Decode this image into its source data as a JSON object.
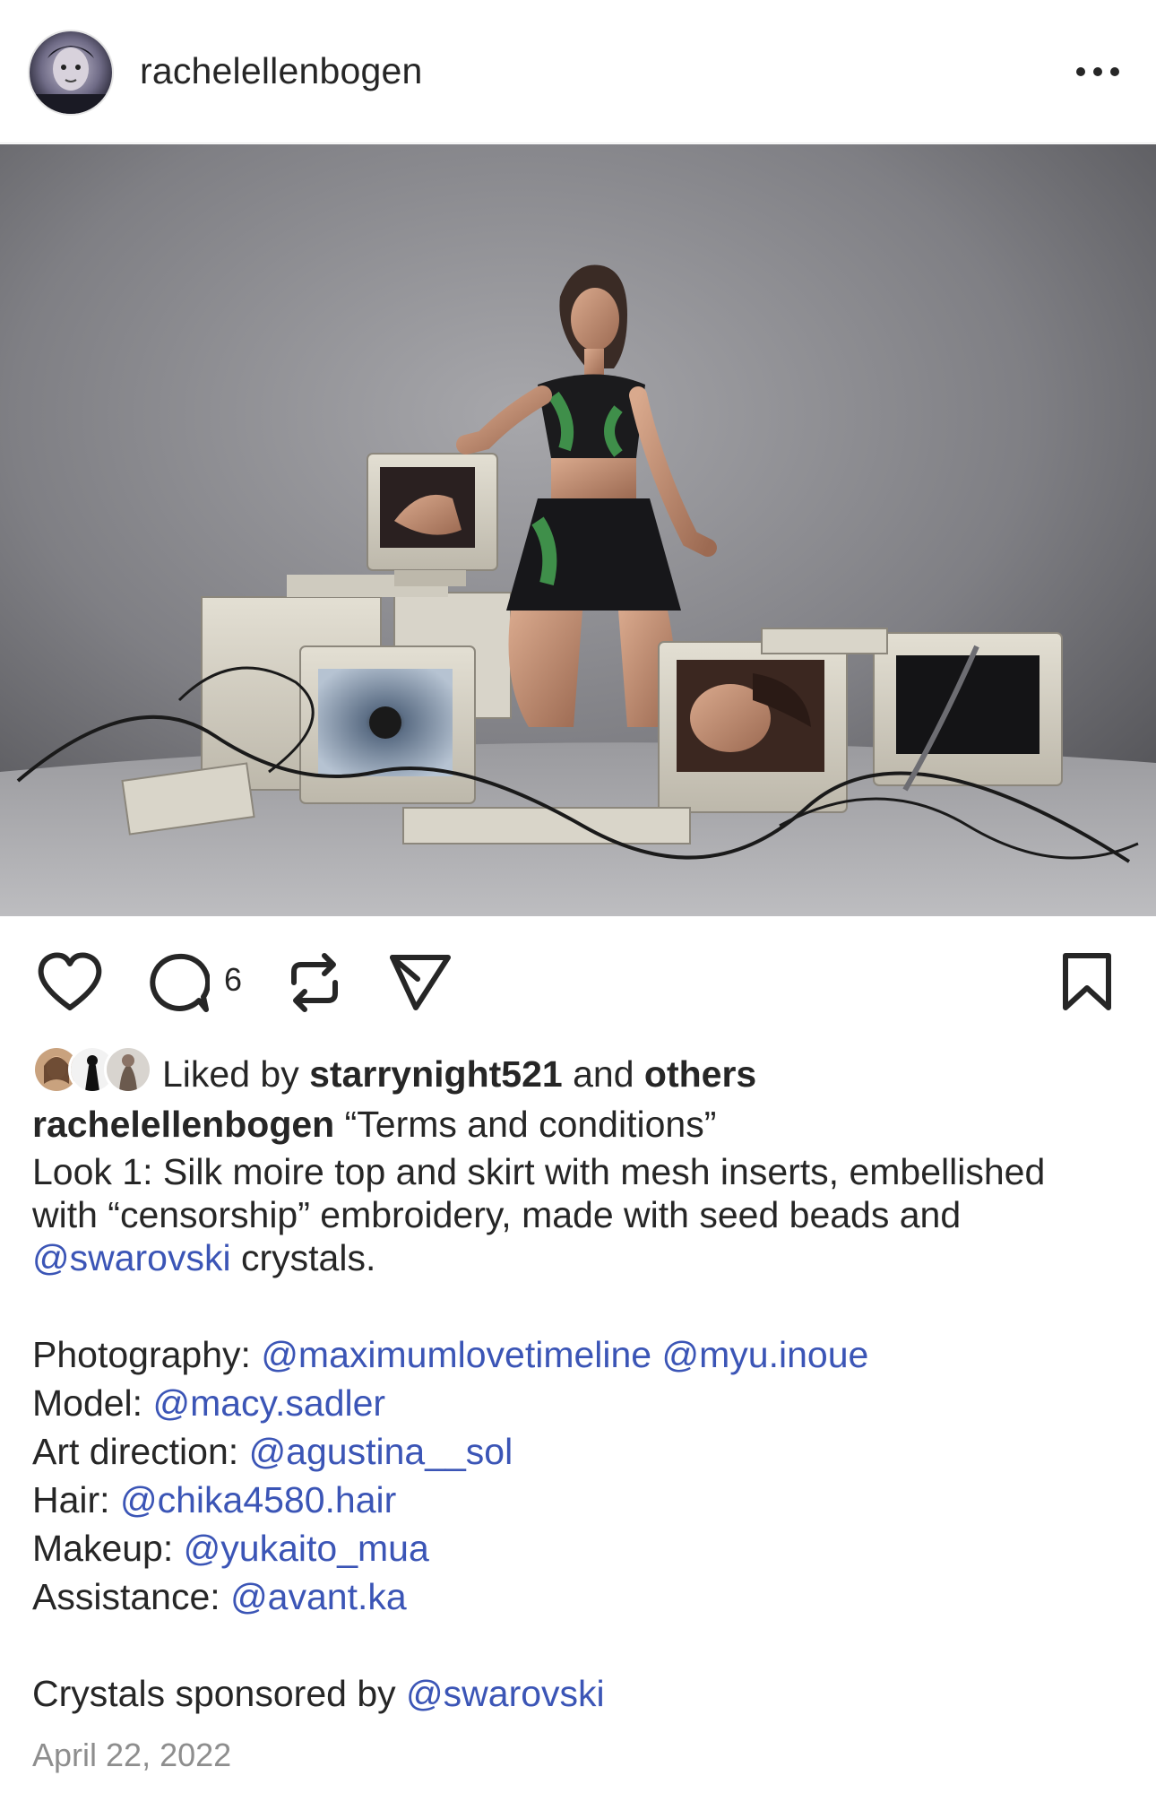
{
  "header": {
    "username": "rachelellenbogen",
    "more_icon": "more-horizontal-icon"
  },
  "post": {
    "image_alt": "Model kneeling among vintage CRT computer monitors, keyboards and cables",
    "actions": {
      "like_icon": "heart-icon",
      "comment_icon": "comment-icon",
      "comment_count": "6",
      "repost_icon": "repost-icon",
      "share_icon": "send-icon",
      "save_icon": "bookmark-icon"
    },
    "likes": {
      "prefix": "Liked by",
      "user": "starrynight521",
      "middle": "and",
      "others": "others"
    },
    "caption": {
      "username": "rachelellenbogen",
      "title": "“Terms and conditions”",
      "line1": "Look 1: Silk moire top and skirt with mesh inserts, embellished",
      "line2": "with “censorship” embroidery, made with seed beads and",
      "line3_mention": "@swarovski",
      "line3_text": "crystals.",
      "credits": [
        {
          "label": "Photography:",
          "mentions": [
            "@maximumlovetimeline",
            "@myu.inoue"
          ]
        },
        {
          "label": "Model:",
          "mentions": [
            "@macy.sadler"
          ]
        },
        {
          "label": "Art direction:",
          "mentions": [
            "@agustina__sol"
          ]
        },
        {
          "label": "Hair:",
          "mentions": [
            "@chika4580.hair"
          ]
        },
        {
          "label": "Makeup:",
          "mentions": [
            "@yukaito_mua"
          ]
        },
        {
          "label": "Assistance:",
          "mentions": [
            "@avant.ka"
          ]
        }
      ],
      "sponsor_text": "Crystals sponsored by",
      "sponsor_mention": "@swarovski"
    },
    "date": "April 22, 2022"
  },
  "colors": {
    "mention": "#3b55b6",
    "text": "#262626",
    "muted": "#8e8e8e"
  }
}
